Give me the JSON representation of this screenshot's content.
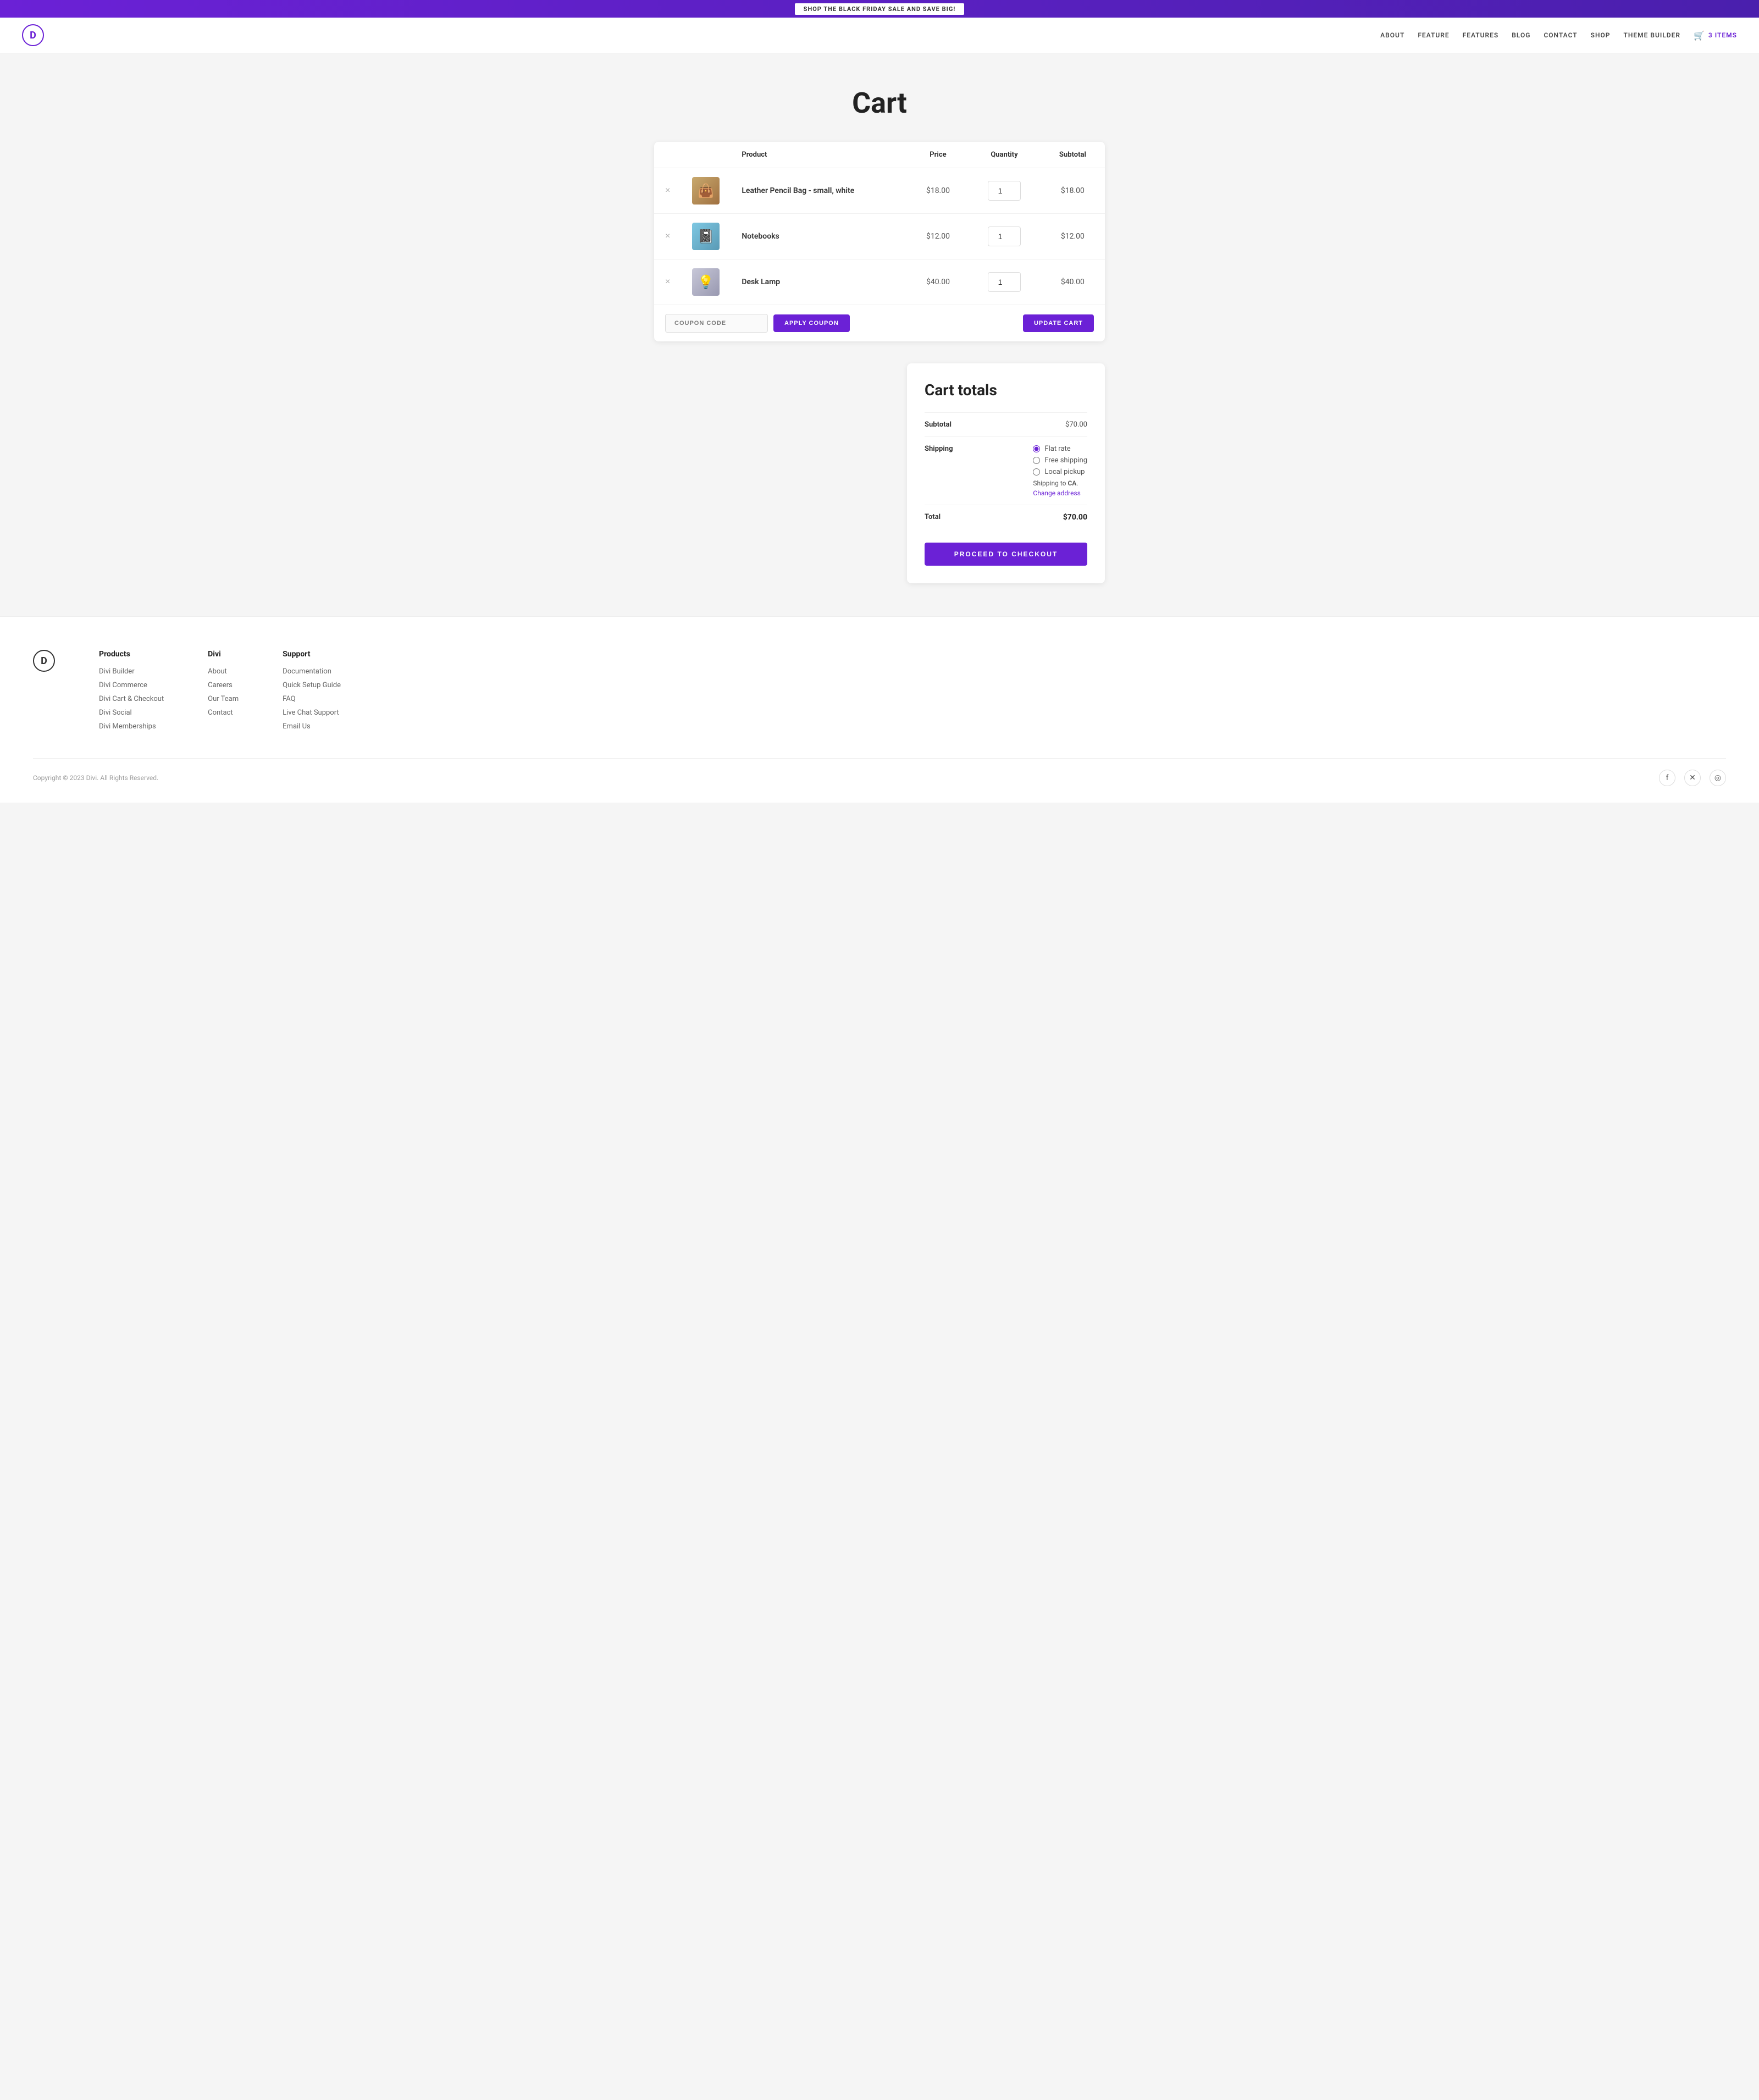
{
  "banner": {
    "text": "SHOP THE BLACK FRIDAY SALE AND SAVE BIG!"
  },
  "header": {
    "logo_letter": "D",
    "nav": {
      "about": "ABOUT",
      "feature": "FEATURE",
      "features": "FEATURES",
      "blog": "BLOG",
      "contact": "CONTACT",
      "shop": "SHOP",
      "theme_builder": "THEME BUILDER",
      "cart_items": "3 ITEMS"
    }
  },
  "page_title": "Cart",
  "cart_table": {
    "headers": {
      "product": "Product",
      "price": "Price",
      "quantity": "Quantity",
      "subtotal": "Subtotal"
    },
    "items": [
      {
        "id": 1,
        "name": "Leather Pencil Bag - small, white",
        "price": "$18.00",
        "quantity": 1,
        "subtotal": "$18.00",
        "img_type": "pencil-bag"
      },
      {
        "id": 2,
        "name": "Notebooks",
        "price": "$12.00",
        "quantity": 1,
        "subtotal": "$12.00",
        "img_type": "notebooks"
      },
      {
        "id": 3,
        "name": "Desk Lamp",
        "price": "$40.00",
        "quantity": 1,
        "subtotal": "$40.00",
        "img_type": "desk-lamp"
      }
    ]
  },
  "coupon": {
    "placeholder": "COUPON CODE",
    "apply_label": "APPLY COUPON"
  },
  "update_cart_label": "UPDATE CART",
  "cart_totals": {
    "title": "Cart totals",
    "subtotal_label": "Subtotal",
    "subtotal_value": "$70.00",
    "shipping_label": "Shipping",
    "shipping_options": [
      {
        "label": "Flat rate",
        "checked": true
      },
      {
        "label": "Free shipping",
        "checked": false
      },
      {
        "label": "Local pickup",
        "checked": false
      }
    ],
    "shipping_to_text": "Shipping to",
    "shipping_state": "CA",
    "change_address": "Change address",
    "total_label": "Total",
    "total_value": "$70.00",
    "checkout_label": "PROCEED TO CHECKOUT"
  },
  "footer": {
    "logo_letter": "D",
    "products_heading": "Products",
    "products_links": [
      "Divi Builder",
      "Divi Commerce",
      "Divi Cart & Checkout",
      "Divi Social",
      "Divi Memberships"
    ],
    "divi_heading": "Divi",
    "divi_links": [
      "About",
      "Careers",
      "Our Team",
      "Contact"
    ],
    "support_heading": "Support",
    "support_links": [
      "Documentation",
      "Quick Setup Guide",
      "FAQ",
      "Live Chat Support",
      "Email Us"
    ],
    "copyright": "Copyright © 2023 Divi. All Rights Reserved."
  }
}
